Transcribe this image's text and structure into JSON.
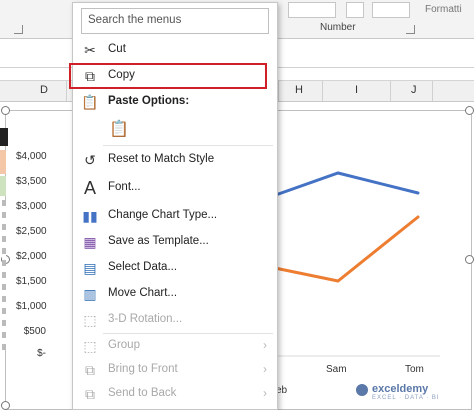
{
  "ribbon": {
    "group_number": "Number",
    "group_formatting": "Formatti"
  },
  "columns": [
    "D",
    "H",
    "I",
    "J"
  ],
  "chart_data": {
    "type": "line",
    "categories": [
      "Sam",
      "Tom"
    ],
    "series": [
      {
        "color": "#4472c4"
      },
      {
        "color": "#ed7d31"
      }
    ],
    "yticks": [
      "$4,000",
      "$3,500",
      "$3,000",
      "$2,500",
      "$2,000",
      "$1,500",
      "$1,000",
      "$500",
      "$-"
    ],
    "ylim": [
      0,
      4000
    ],
    "partial_label": "eb"
  },
  "context_menu": {
    "search_placeholder": "Search the menus",
    "items": {
      "cut": "Cut",
      "copy": "Copy",
      "paste_options": "Paste Options:",
      "reset": "Reset to Match Style",
      "font": "Font...",
      "change_type": "Change Chart Type...",
      "save_template": "Save as Template...",
      "select_data": "Select Data...",
      "move_chart": "Move Chart...",
      "rotation": "3-D Rotation...",
      "group": "Group",
      "bring_front": "Bring to Front",
      "send_back": "Send to Back"
    },
    "highlight_color": "#d11f26"
  },
  "watermark": {
    "name": "exceldemy",
    "tagline": "EXCEL · DATA · BI"
  }
}
